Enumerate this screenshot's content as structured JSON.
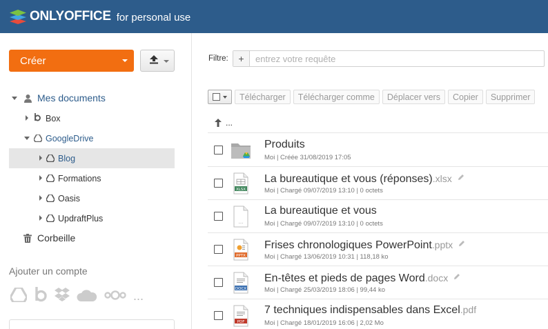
{
  "header": {
    "brand": "ONLYOFFICE",
    "subtitle": "for personal use",
    "colors": {
      "bar": "#2d5c8b",
      "logo_top": "#7bc242",
      "logo_mid": "#41a5e3",
      "logo_bottom": "#e74c3c"
    }
  },
  "sidebar": {
    "create_label": "Créer",
    "create_color": "#f26e11",
    "tree": {
      "root": "Mes documents",
      "box": "Box",
      "googledrive": "GoogleDrive",
      "children": [
        "Blog",
        "Formations",
        "Oasis",
        "UpdraftPlus"
      ],
      "selected": "Blog",
      "trash": "Corbeille"
    },
    "add_account_label": "Ajouter un compte",
    "account_icons": [
      "google-drive-icon",
      "box-icon",
      "dropbox-icon",
      "onedrive-icon",
      "nextcloud-icon",
      "more-icon"
    ],
    "more_label": "..."
  },
  "main": {
    "filter_label": "Filtre:",
    "filter_plus": "+",
    "filter_placeholder": "entrez votre requête",
    "toolbar": {
      "download": "Télécharger",
      "download_as": "Télécharger comme",
      "move_to": "Déplacer vers",
      "copy": "Copier",
      "delete": "Supprimer"
    },
    "up_label": "...",
    "files": [
      {
        "name": "Produits",
        "ext": "",
        "meta": "Moi | Créée 31/08/2019 17:05",
        "type": "folder"
      },
      {
        "name": "La bureautique et vous (réponses)",
        "ext": ".xlsx",
        "meta": "Moi | Chargé 09/07/2019 13:10 | 0 octets",
        "type": "xlsx",
        "badge": "XLSX"
      },
      {
        "name": "La bureautique et vous",
        "ext": "",
        "meta": "Moi | Chargé 09/07/2019 13:10 | 0 octets",
        "type": "blank",
        "badge": "..."
      },
      {
        "name": "Frises chronologiques PowerPoint",
        "ext": ".pptx",
        "meta": "Moi | Chargé 13/06/2019 10:31 | 118,18 ko",
        "type": "pptx",
        "badge": "PPTX"
      },
      {
        "name": "En-têtes et pieds de pages Word",
        "ext": ".docx",
        "meta": "Moi | Chargé 25/03/2019 18:06 | 99,44 ko",
        "type": "docx",
        "badge": "DOCX"
      },
      {
        "name": "7 techniques indispensables dans Excel",
        "ext": ".pdf",
        "meta": "Moi | Chargé 18/01/2019 16:06 | 2,02 Mo",
        "type": "pdf",
        "badge": "PDF"
      }
    ]
  }
}
